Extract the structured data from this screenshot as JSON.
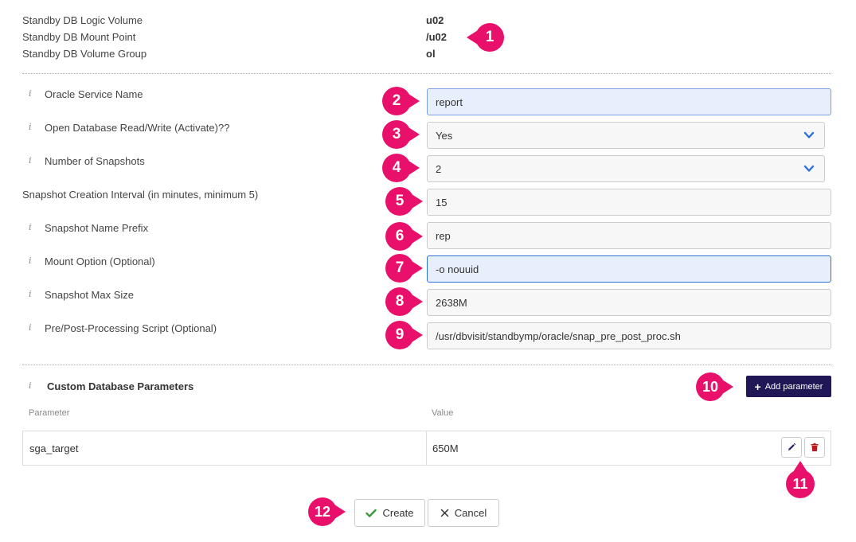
{
  "standby_info": [
    {
      "label": "Standby DB Logic Volume",
      "value": "u02"
    },
    {
      "label": "Standby DB Mount Point",
      "value": "/u02"
    },
    {
      "label": "Standby DB Volume Group",
      "value": "ol"
    }
  ],
  "fields": [
    {
      "label": "Oracle Service Name",
      "value": "report",
      "type": "text",
      "info_icon": "i"
    },
    {
      "label": "Open Database Read/Write (Activate)??",
      "value": "Yes",
      "type": "select",
      "info_icon": "i"
    },
    {
      "label": "Number of Snapshots",
      "value": "2",
      "type": "select",
      "info_icon": "i"
    },
    {
      "label": "Snapshot Creation Interval (in minutes, minimum 5)",
      "value": "15",
      "type": "text"
    },
    {
      "label": "Snapshot Name Prefix",
      "value": "rep",
      "type": "text",
      "info_icon": "i"
    },
    {
      "label": "Mount Option (Optional)",
      "value": "-o nouuid",
      "type": "text",
      "info_icon": "i"
    },
    {
      "label": "Snapshot Max Size",
      "value": "2638M",
      "type": "text",
      "info_icon": "i"
    },
    {
      "label": "Pre/Post-Processing Script (Optional)",
      "value": "/usr/dbvisit/standbymp/oracle/snap_pre_post_proc.sh",
      "type": "text",
      "info_icon": "i"
    }
  ],
  "custom_params": {
    "info_icon": "i",
    "title": "Custom Database Parameters",
    "add_button_label": "Add parameter",
    "add_button_icon": "+",
    "columns": [
      "Parameter",
      "Value"
    ],
    "rows": [
      {
        "parameter": "sga_target",
        "value": "650M"
      }
    ]
  },
  "actions": {
    "create_label": "Create",
    "cancel_label": "Cancel"
  },
  "callouts": [
    "1",
    "2",
    "3",
    "4",
    "5",
    "6",
    "7",
    "8",
    "9",
    "10",
    "11",
    "12"
  ],
  "colors": {
    "callout": "#e8106a",
    "primary_button": "#1f1756",
    "delete_icon": "#c0181e",
    "check_icon": "#3a9a3a",
    "chevron": "#2f6fd8"
  }
}
